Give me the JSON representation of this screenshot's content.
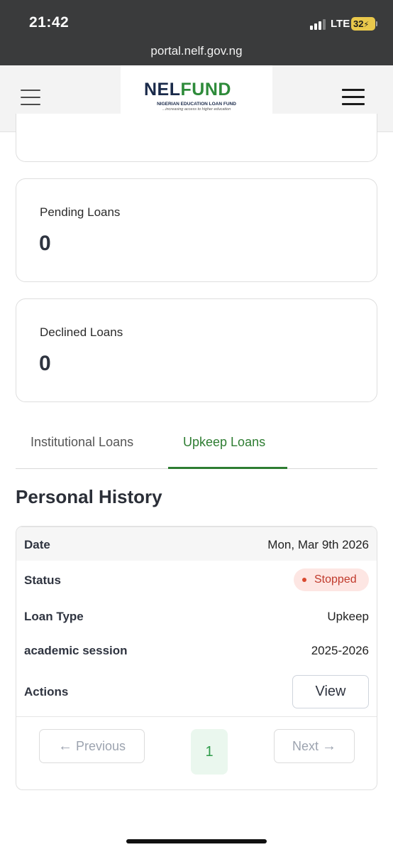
{
  "status_bar": {
    "time": "21:42",
    "network": "LTE",
    "battery": "32",
    "battery_color": "#e9c84b"
  },
  "browser": {
    "url": "portal.nelf.gov.ng"
  },
  "header": {
    "logo": {
      "word_left": "NEL",
      "word_right": "FUND",
      "subtitle": "NIGERIAN EDUCATION LOAN FUND",
      "tagline": "...increasing access to higher education"
    },
    "left_menu_icon": "hamburger-icon",
    "right_menu_icon": "hamburger-icon"
  },
  "cards": [
    {
      "label": "Pending Loans",
      "value": "0"
    },
    {
      "label": "Declined Loans",
      "value": "0"
    }
  ],
  "tabs": [
    {
      "label": "Institutional Loans",
      "active": false
    },
    {
      "label": "Upkeep Loans",
      "active": true
    }
  ],
  "section_title": "Personal History",
  "history": {
    "date_label": "Date",
    "date_value": "Mon, Mar 9th 2026",
    "status_label": "Status",
    "status_value": "Stopped",
    "type_label": "Loan Type",
    "type_value": "Upkeep",
    "session_label": "academic session",
    "session_value": "2025-2026",
    "actions_label": "Actions",
    "view_label": "View"
  },
  "pagination": {
    "previous_label": "Previous",
    "next_label": "Next",
    "current_page": "1"
  },
  "colors": {
    "accent_green": "#2e7d32",
    "status_stopped": "#c0392b",
    "status_bg": "#fde6e3"
  }
}
